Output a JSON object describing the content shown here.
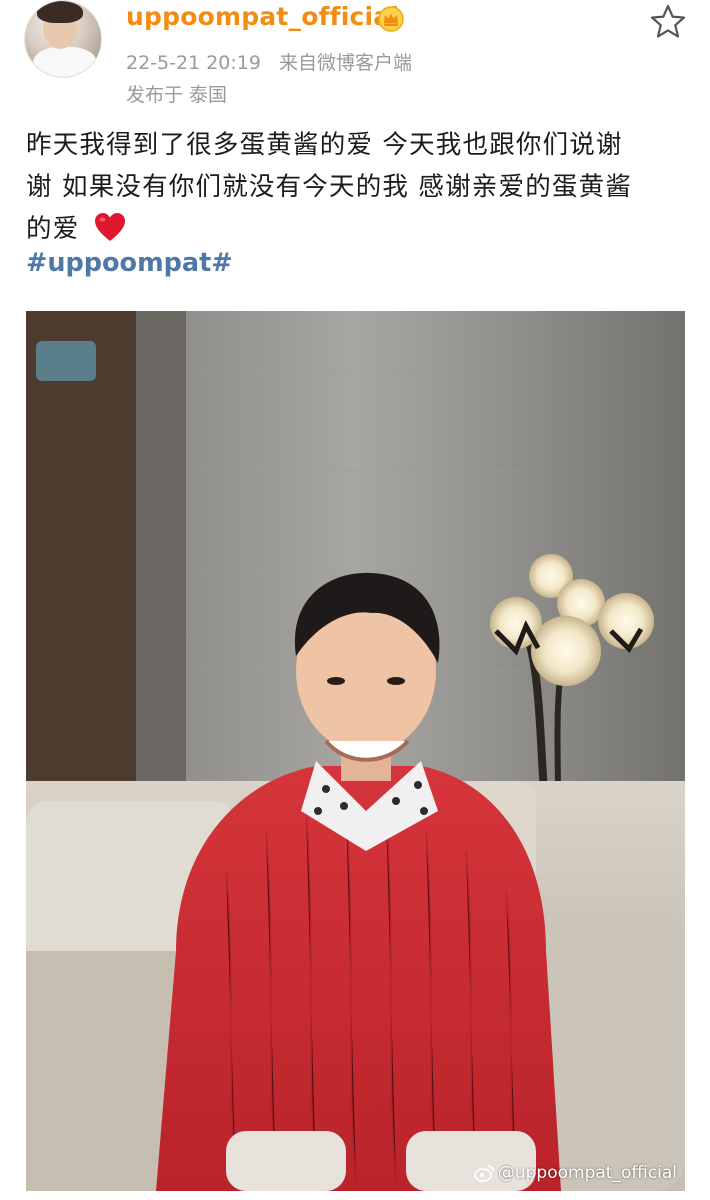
{
  "post": {
    "username": "uppoompat_official",
    "timestamp": "22-5-21 20:19",
    "source": "来自微博客户端",
    "location": "发布于 泰国",
    "text_line1": "昨天我得到了很多蛋黄酱的爱 今天我也跟你们说谢",
    "text_line2": "谢 如果没有你们就没有今天的我 感谢亲爱的蛋黄酱",
    "text_line3": "的爱",
    "hashtag": "#uppoompat#"
  },
  "photo": {
    "watermark": "@uppoompat_official"
  },
  "icons": {
    "verified": "crown-icon",
    "favorite": "star-icon",
    "emoji": "red-heart-icon",
    "weibo": "weibo-logo-icon"
  },
  "colors": {
    "username": "#f38d11",
    "hashtag": "#4f78a8",
    "meta": "#9a9a9a",
    "heart": "#e0182d"
  }
}
